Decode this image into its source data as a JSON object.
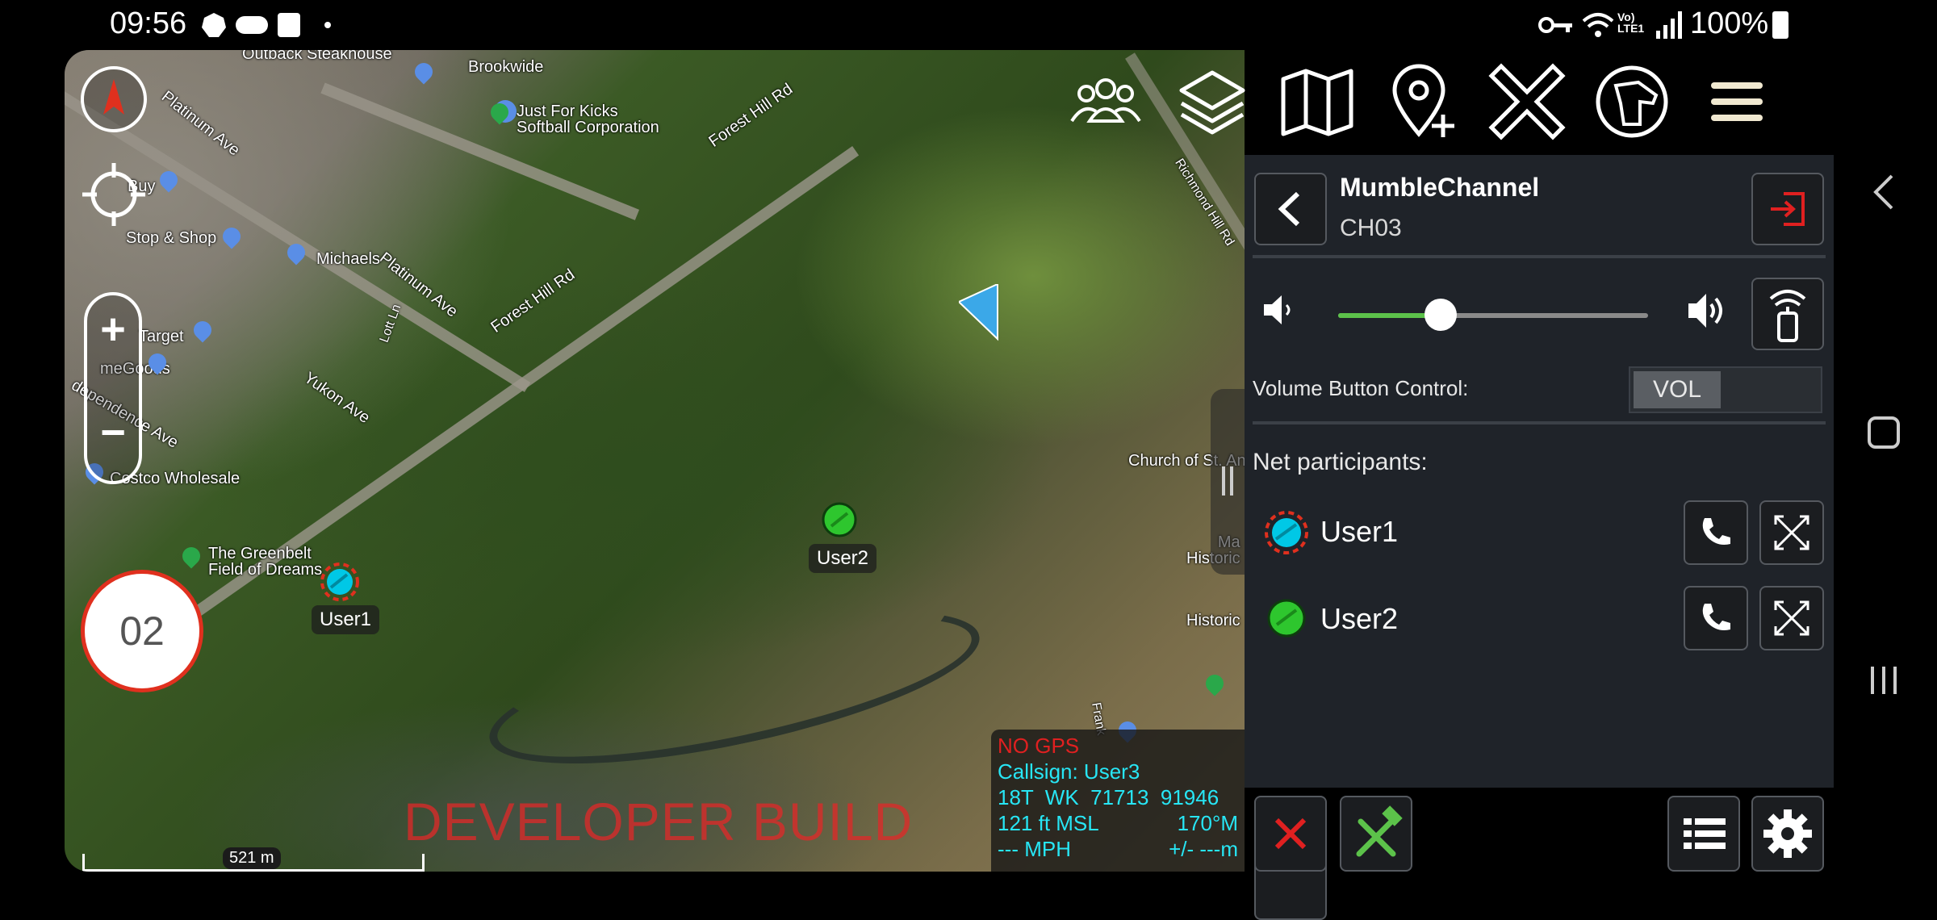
{
  "status_bar": {
    "time": "09:56",
    "battery": "100%"
  },
  "map": {
    "labels": {
      "outback": "Outback Steakhouse",
      "brookwide": "Brookwide",
      "platinum1": "Platinum Ave",
      "platinum2": "Platinum Ave",
      "justforkicks": "Just For Kicks\nSoftball Corporation",
      "foresthill1": "Forest Hill Rd",
      "foresthill2": "Forest Hill Rd",
      "buy": "Buy",
      "stopshop": "Stop & Shop",
      "michaels": "Michaels",
      "lottie": "Lott Ln",
      "target": "Target",
      "homegoods": "meGoods",
      "yukon": "Yukon Ave",
      "independence": "dependence Ave",
      "costco": "Costco Wholesale",
      "greenbelt": "The Greenbelt\nField of Dreams",
      "richmond": "Richmond Hill Rd",
      "church": "Church of St. An",
      "historic1": "Ma\nHistoric",
      "historic2": "Historic",
      "frank": "Frank"
    },
    "compass_label": "compass",
    "zoom_in": "+",
    "zoom_out": "−",
    "channel_badge": "02",
    "users": [
      {
        "name": "User1",
        "color": "#00c8e6"
      },
      {
        "name": "User2",
        "color": "#2ec62e"
      }
    ],
    "watermark": "DEVELOPER BUILD",
    "scale_label": "521 m",
    "info": {
      "gps": "NO GPS",
      "callsign": "Callsign: User3",
      "grid": "18T  WK  71713  91946",
      "altitude": "121 ft MSL",
      "heading": "170°M",
      "speed": "--- MPH",
      "accuracy": "+/- ---m"
    }
  },
  "toolbar": {
    "icons": [
      "groups-icon",
      "layers-icon",
      "map-icon",
      "add-marker-icon",
      "close-tools-icon",
      "dog-icon",
      "menu-icon"
    ]
  },
  "panel": {
    "channel_name": "MumbleChannel",
    "channel_id": "CH03",
    "volume_fraction": 0.33,
    "volume_label": "Volume Button Control:",
    "volume_toggle": "VOL",
    "participants_label": "Net participants:",
    "participants": [
      {
        "name": "User1",
        "color": "#00c8e6"
      },
      {
        "name": "User2",
        "color": "#2ec62e"
      }
    ]
  },
  "colors": {
    "accent_green": "#5cc24a",
    "alert_red": "#e02020",
    "info_cyan": "#27e6f5"
  }
}
